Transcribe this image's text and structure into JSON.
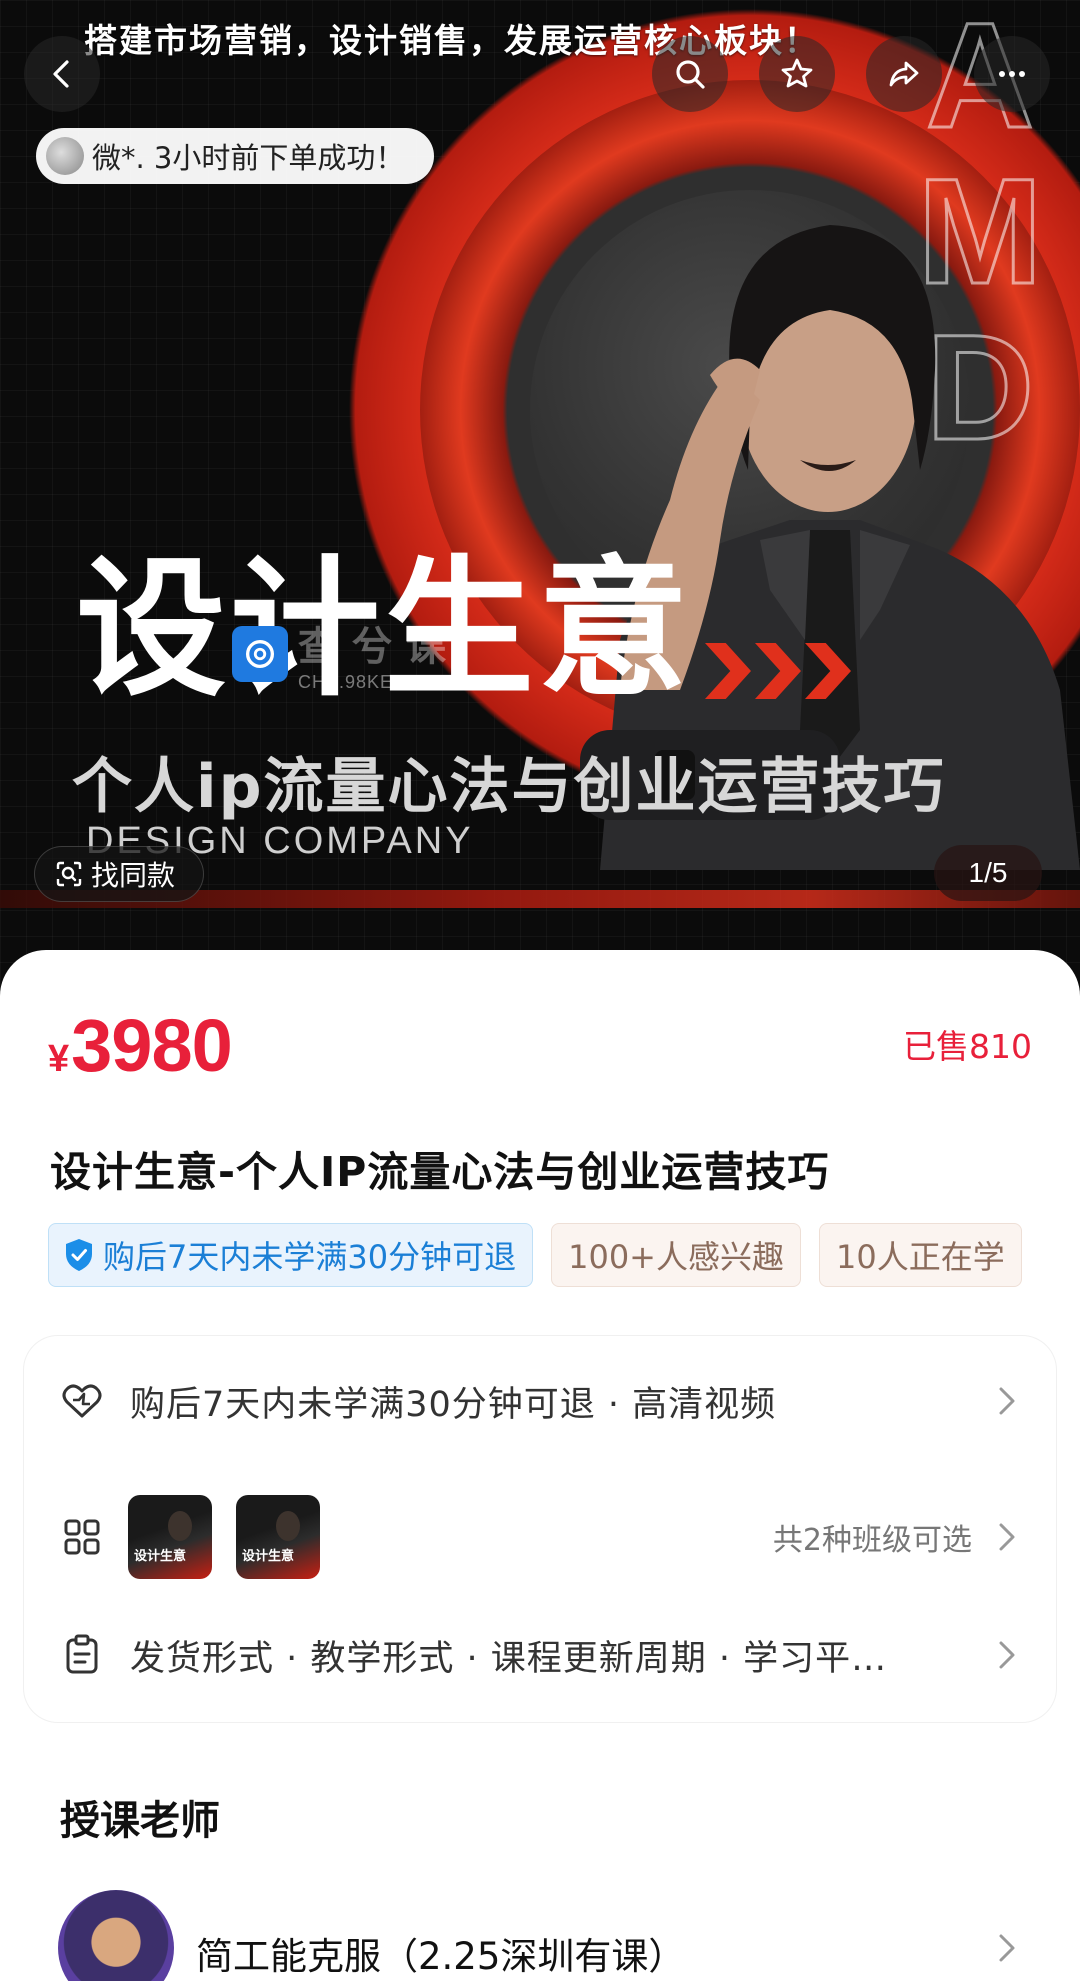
{
  "hero": {
    "top_text": "搭建市场营销，设计销售，发展运营核心板块！",
    "order_notice": "微*. 3小时前下单成功！",
    "title": "设计生意",
    "subtitle": "个人ip流量心法与创业运营技巧",
    "company": "DESIGN COMPANY",
    "side_letters": [
      "A",
      "M",
      "D"
    ],
    "watermark_text": "查兮课",
    "watermark_domain": "CHA.98KE.COM",
    "find_similar_label": "找同款",
    "page_indicator": "1/5"
  },
  "product": {
    "currency": "¥",
    "price": "3980",
    "sold": "已售810",
    "title": "设计生意-个人IP流量心法与创业运营技巧",
    "tags": [
      {
        "label": "购后7天内未学满30分钟可退",
        "type": "refund"
      },
      {
        "label": "100+人感兴趣",
        "type": "plain"
      },
      {
        "label": "10人正在学",
        "type": "plain"
      }
    ]
  },
  "info_rows": {
    "refund_text": "购后7天内未学满30分钟可退 · 高清视频",
    "class_thumbs": [
      "设计生意",
      "设计生意"
    ],
    "class_right": "共2种班级可选",
    "details_text": "发货形式 · 教学形式 · 课程更新周期 · 学习平…"
  },
  "teacher": {
    "heading": "授课老师",
    "name": "简工能克服（2.25深圳有课）"
  },
  "colors": {
    "accent_red": "#e8203a",
    "hero_red": "#e0301c",
    "refund_blue": "#1b7fd6"
  }
}
